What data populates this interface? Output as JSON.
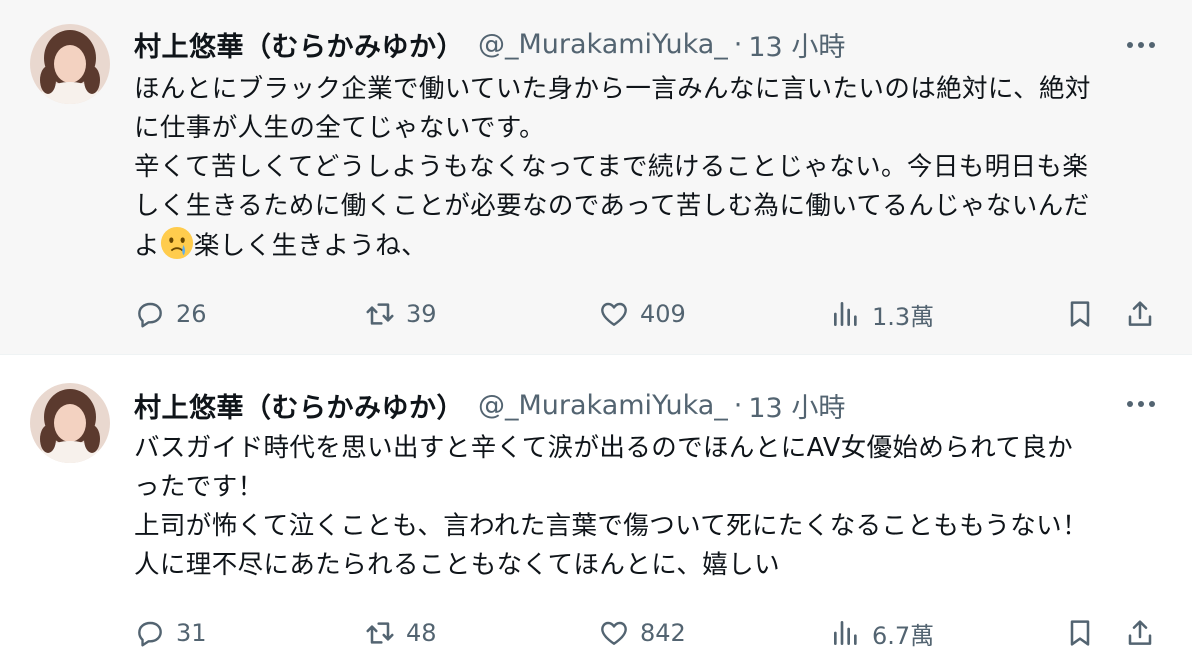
{
  "colors": {
    "text_primary": "#0f1419",
    "text_secondary": "#536471",
    "highlight_bg": "#f7f7f7"
  },
  "tweets": [
    {
      "author_name": "村上悠華（むらかみゆか）",
      "handle": "@_MurakamiYuka_",
      "separator": "·",
      "time": "13 小時",
      "lines": [
        "ほんとにブラック企業で働いていた身から一言みんなに言いたいのは絶対に、絶対",
        "に仕事が人生の全てじゃないです。",
        "辛くて苦しくてどうしようもなくなってまで続けることじゃない。今日も明日も楽",
        "しく生きるために働くことが必要なのであって苦しむ為に働いてるんじゃないんだ",
        "よ",
        "楽しく生きようね、"
      ],
      "emoji_icon": "crying-face-emoji",
      "replies": "26",
      "retweets": "39",
      "likes": "409",
      "views": "1.3萬"
    },
    {
      "author_name": "村上悠華（むらかみゆか）",
      "handle": "@_MurakamiYuka_",
      "separator": "·",
      "time": "13 小時",
      "lines": [
        "バスガイド時代を思い出すと辛くて涙が出るのでほんとにAV女優始められて良か",
        "ったです！",
        "上司が怖くて泣くことも、言われた言葉で傷ついて死にたくなることももうない！",
        "人に理不尽にあたられることもなくてほんとに、嬉しい"
      ],
      "replies": "31",
      "retweets": "48",
      "likes": "842",
      "views": "6.7萬"
    }
  ]
}
